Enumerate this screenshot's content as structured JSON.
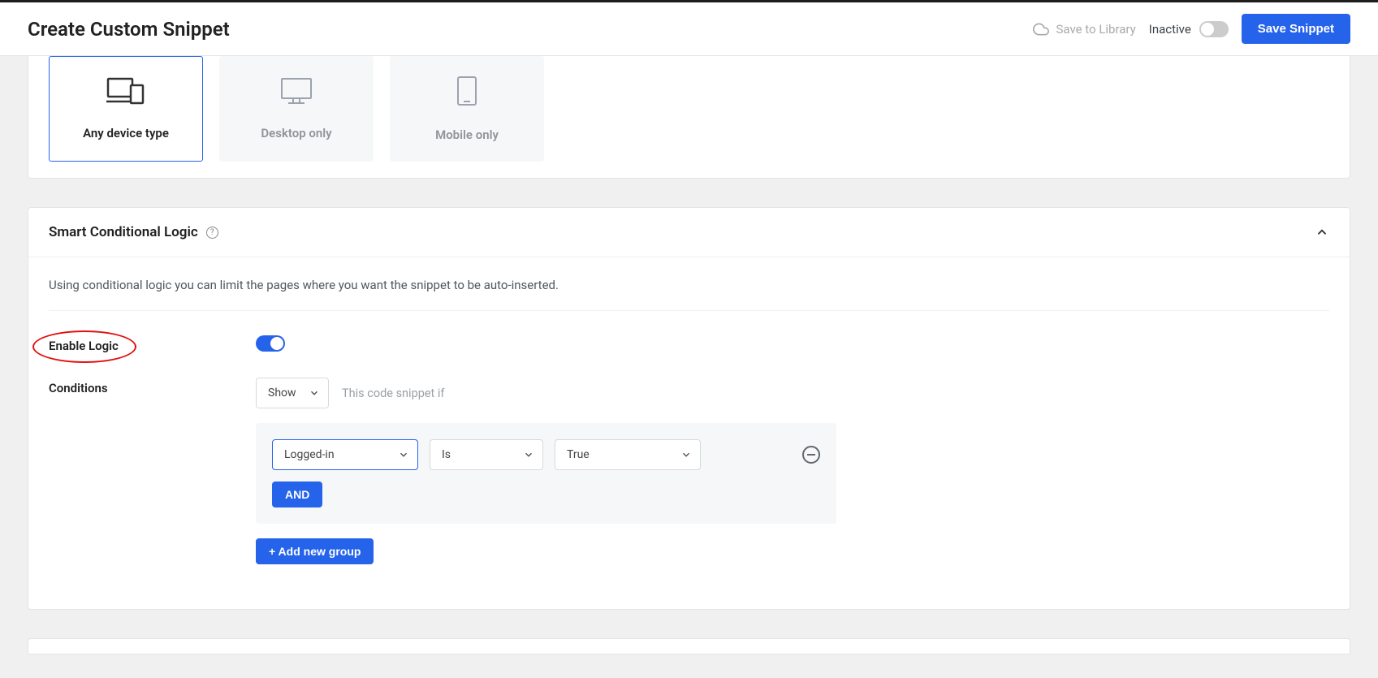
{
  "header": {
    "title": "Create Custom Snippet",
    "save_library": "Save to Library",
    "status_label": "Inactive",
    "save_button": "Save Snippet"
  },
  "device": {
    "any": "Any device type",
    "desktop": "Desktop only",
    "mobile": "Mobile only"
  },
  "logic": {
    "title": "Smart Conditional Logic",
    "description": "Using conditional logic you can limit the pages where you want the snippet to be auto-inserted.",
    "enable_label": "Enable Logic",
    "conditions_label": "Conditions",
    "show_label": "Show",
    "snippet_if": "This code snippet if",
    "cond_subject": "Logged-in",
    "cond_op": "Is",
    "cond_value": "True",
    "and_label": "AND",
    "add_group": "+ Add new group"
  }
}
